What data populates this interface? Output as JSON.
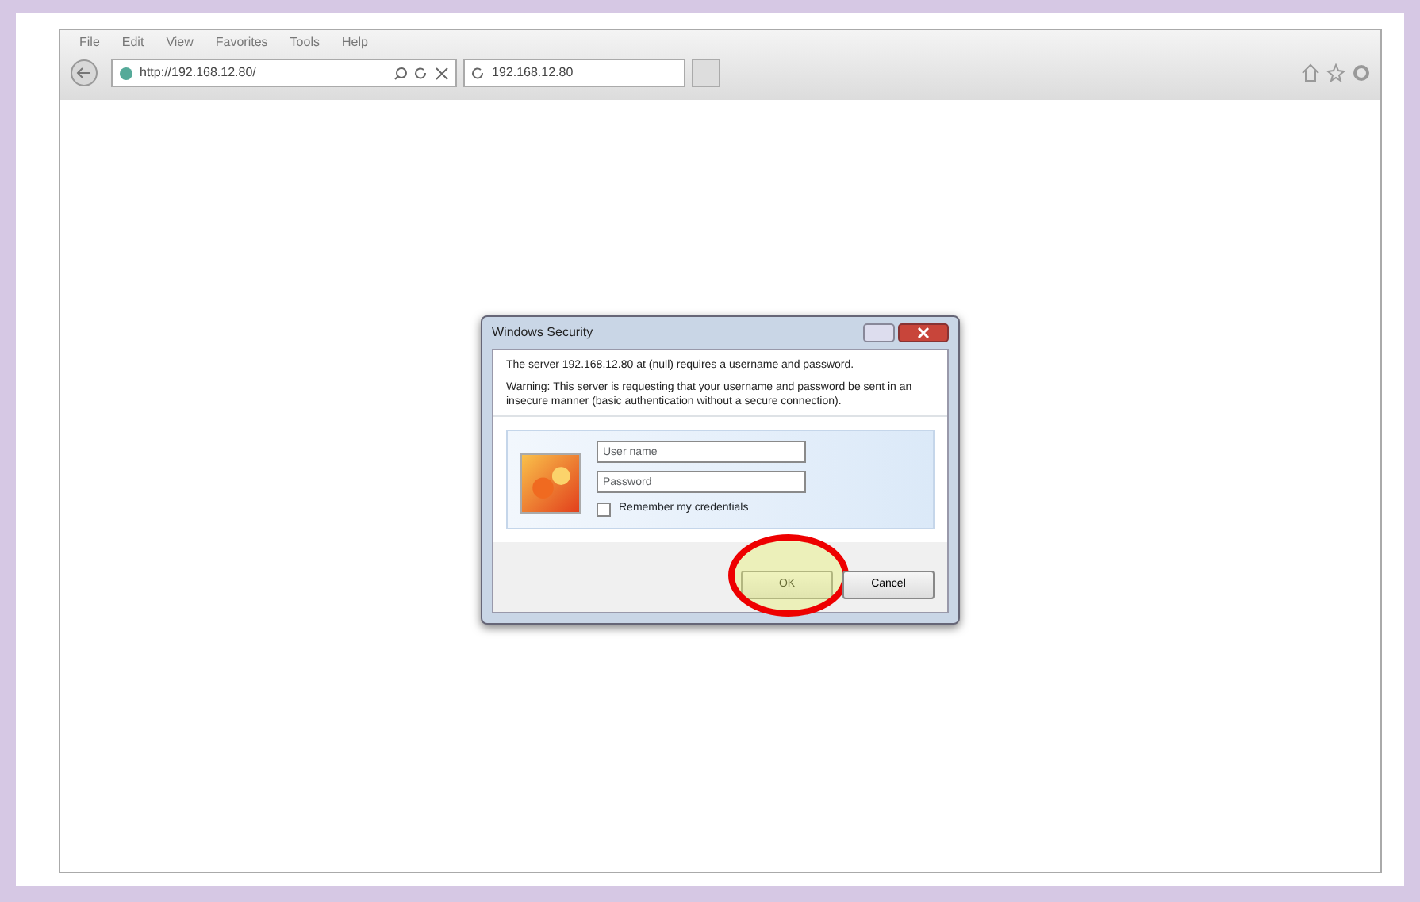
{
  "menu": [
    "File",
    "Edit",
    "View",
    "Favorites",
    "Tools",
    "Help"
  ],
  "address_bar": {
    "url": "http://192.168.12.80/"
  },
  "tab": {
    "title": "192.168.12.80"
  },
  "dialog": {
    "title": "Windows Security",
    "message": "The server 192.168.12.80 at (null) requires a username and password.",
    "warning": "Warning: This server is requesting that your username and password be sent in an insecure manner (basic authentication without a secure connection).",
    "fields": [
      {
        "placeholder": "User name"
      },
      {
        "placeholder": "Password"
      }
    ],
    "remember": {
      "label": "Remember my credentials",
      "checked": false
    },
    "buttons": [
      {
        "label": "OK",
        "highlighted": true
      },
      {
        "label": "Cancel",
        "highlighted": false
      }
    ]
  }
}
